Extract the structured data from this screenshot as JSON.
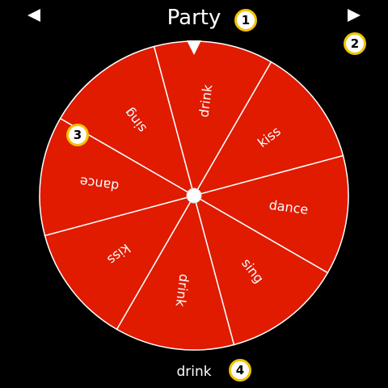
{
  "header": {
    "title": "Party",
    "prev_icon": "triangle-left-icon",
    "next_icon": "triangle-right-icon"
  },
  "wheel": {
    "segments": [
      "drink",
      "kiss",
      "dance",
      "sing",
      "drink",
      "kiss",
      "dance",
      "sing"
    ],
    "fill_color": "#e01b00",
    "line_color": "#ffffff",
    "pointer_icon": "triangle-down-icon"
  },
  "result": {
    "value": "drink"
  },
  "callouts": [
    "1",
    "2",
    "3",
    "4"
  ]
}
